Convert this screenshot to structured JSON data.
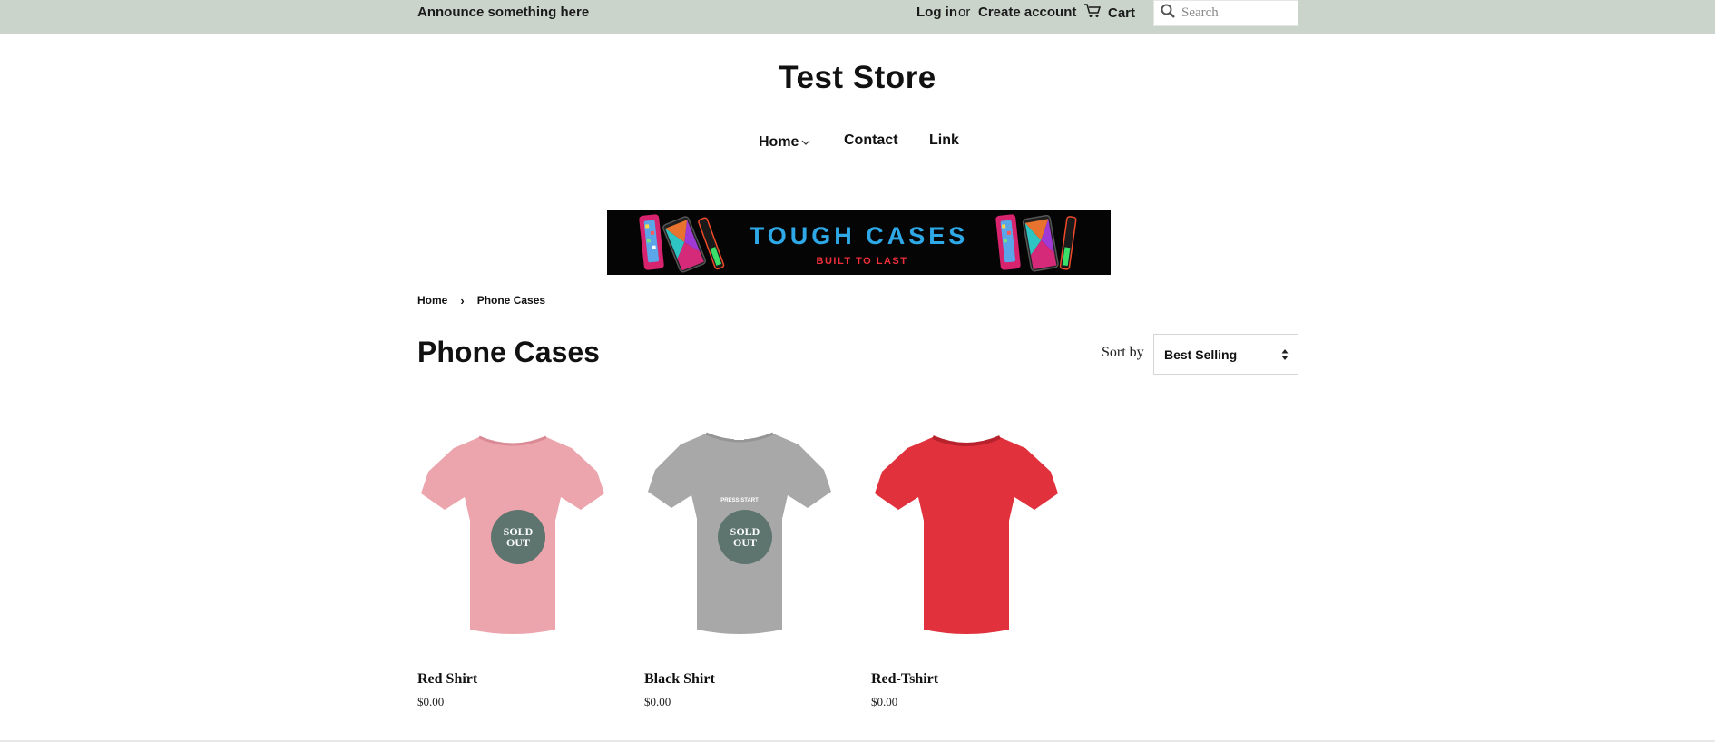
{
  "topbar": {
    "announcement": "Announce something here",
    "login": "Log in",
    "or": "or",
    "create_account": "Create account",
    "cart": "Cart",
    "search_placeholder": "Search",
    "background": "#cad4cb"
  },
  "header": {
    "store_name": "Test Store",
    "nav": [
      {
        "label": "Home",
        "has_dropdown": true
      },
      {
        "label": "Contact"
      },
      {
        "label": "Link"
      }
    ]
  },
  "banner": {
    "title": "TOUGH CASES",
    "subtitle": "BUILT TO LAST",
    "title_color": "#2ea8e6",
    "subtitle_color": "#f02e3a"
  },
  "breadcrumb": [
    "Home",
    "Phone Cases"
  ],
  "collection": {
    "title": "Phone Cases",
    "sort_label": "Sort by",
    "sort_value": "Best Selling"
  },
  "products": [
    {
      "title": "Red Shirt",
      "price": "$0.00",
      "sold_out": true,
      "sold_out_label": [
        "SOLD",
        "OUT"
      ],
      "color": "#eda5ad",
      "print": ""
    },
    {
      "title": "Black Shirt",
      "price": "$0.00",
      "sold_out": true,
      "sold_out_label": [
        "SOLD",
        "OUT"
      ],
      "color": "#a8a8a8",
      "print": "PRESS START"
    },
    {
      "title": "Red-Tshirt",
      "price": "$0.00",
      "sold_out": false,
      "color": "#e0313d",
      "print": ""
    }
  ]
}
